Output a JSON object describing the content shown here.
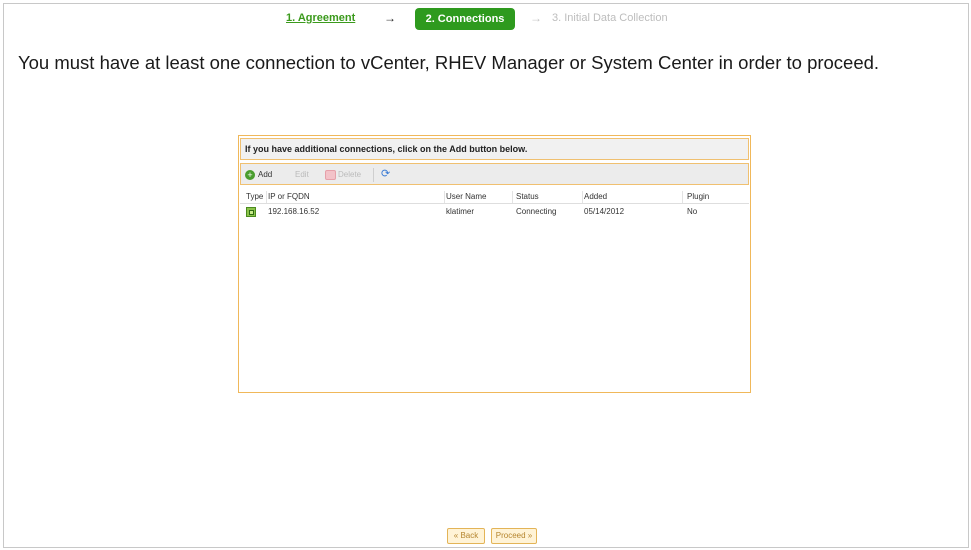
{
  "wizard": {
    "step1": "1. Agreement",
    "step2": "2. Connections",
    "step3": "3. Initial Data Collection",
    "arrow": "→"
  },
  "headline": "You must have at least one connection to vCenter, RHEV Manager or System Center in order to proceed.",
  "panel": {
    "header": "If you have additional connections, click on the Add button below."
  },
  "toolbar": {
    "add_label": "Add",
    "edit_label": "Edit",
    "delete_label": "Delete"
  },
  "table": {
    "columns": [
      "Type",
      "IP or FQDN",
      "User Name",
      "Status",
      "Added",
      "Plugin"
    ],
    "rows": [
      {
        "ip": "192.168.16.52",
        "user": "klatimer",
        "status": "Connecting",
        "added": "05/14/2012",
        "plugin": "No"
      }
    ]
  },
  "footer": {
    "back_label": "« Back",
    "proceed_label": "Proceed »"
  },
  "colors": {
    "accent": "#2e9a1e",
    "panel_border": "#f0b85a"
  }
}
